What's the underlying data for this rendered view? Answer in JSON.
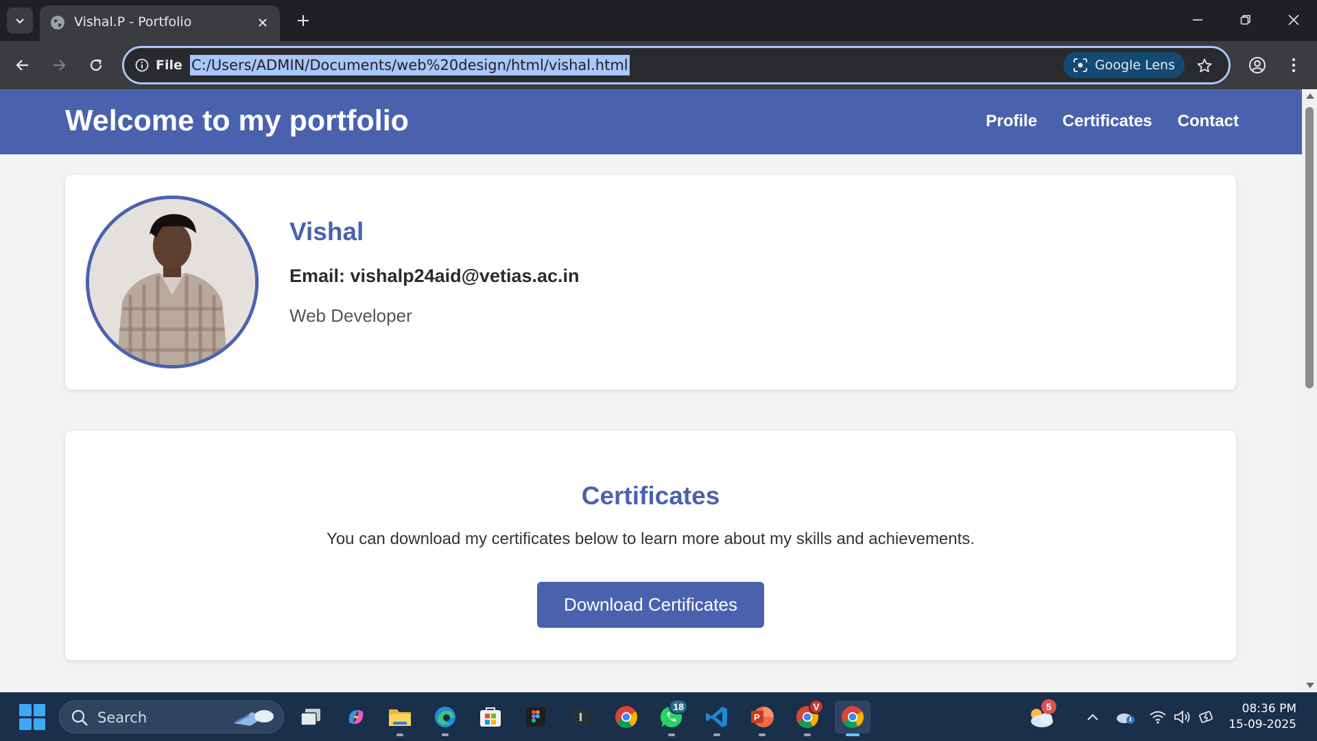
{
  "browser": {
    "tab_title": "Vishal.P - Portfolio",
    "site_info_label": "File",
    "url": "C:/Users/ADMIN/Documents/web%20design/html/vishal.html",
    "lens_label": "Google Lens"
  },
  "site": {
    "title": "Welcome to my portfolio",
    "nav": [
      "Profile",
      "Certificates",
      "Contact"
    ],
    "accent_color": "#4a62ae"
  },
  "profile": {
    "name": "Vishal",
    "email": "Email: vishalp24aid@vetias.ac.in",
    "role": "Web Developer"
  },
  "certificates": {
    "heading": "Certificates",
    "description": "You can download my certificates below to learn more about my skills and achievements.",
    "button_label": "Download Certificates"
  },
  "taskbar": {
    "search_placeholder": "Search",
    "weather_badge": "5",
    "whatsapp_badge": "18",
    "chrome_profile_badge": "V",
    "time": "08:36 PM",
    "date": "15-09-2025"
  }
}
